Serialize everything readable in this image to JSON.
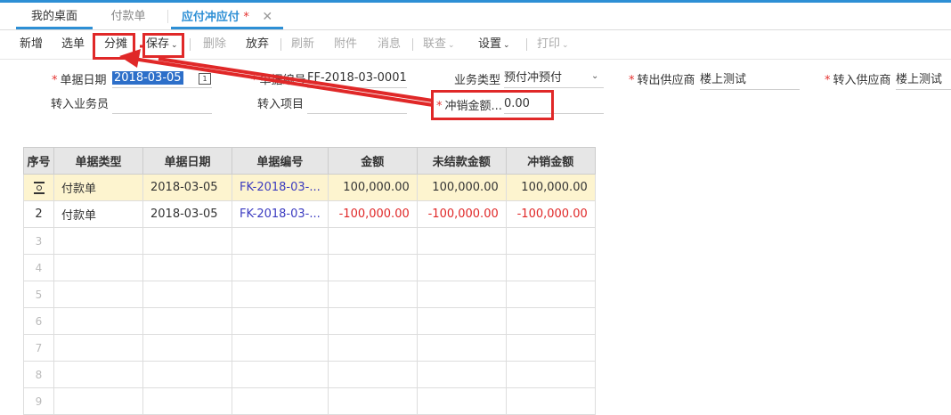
{
  "tabs": {
    "home": "我的桌面",
    "payment": "付款单",
    "active": "应付冲应付",
    "modified_mark": "*",
    "close": "✕"
  },
  "toolbar": {
    "add": "新增",
    "select": "选单",
    "allocate": "分摊",
    "save": "保存",
    "delete": "删除",
    "discard": "放弃",
    "refresh": "刷新",
    "attach": "附件",
    "message": "消息",
    "linkquery": "联查",
    "settings": "设置",
    "print": "打印",
    "chevron": "⌄"
  },
  "form": {
    "doc_date_label": "单据日期",
    "doc_date_value": "2018-03-05",
    "doc_no_label": "单据编号",
    "doc_no_value": "FF-2018-03-0001",
    "biz_type_label": "业务类型",
    "biz_type_value": "预付冲预付",
    "out_supplier_label": "转出供应商",
    "out_supplier_value": "楼上测试",
    "in_supplier_label": "转入供应商",
    "in_supplier_value": "楼上测试",
    "in_salesman_label": "转入业务员",
    "in_salesman_value": "",
    "in_project_label": "转入项目",
    "in_project_value": "",
    "writeoff_label": "冲销金额...",
    "writeoff_value": "0.00",
    "required_mark": "*",
    "calendar_glyph": "1"
  },
  "table": {
    "headers": [
      "序号",
      "单据类型",
      "单据日期",
      "单据编号",
      "金额",
      "未结款金额",
      "冲销金额"
    ],
    "rows": [
      {
        "idx": "",
        "type": "付款单",
        "date": "2018-03-05",
        "no": "FK-2018-03-...",
        "amount": "100,000.00",
        "unsettled": "100,000.00",
        "writeoff": "100,000.00"
      },
      {
        "idx": "2",
        "type": "付款单",
        "date": "2018-03-05",
        "no": "FK-2018-03-...",
        "amount": "-100,000.00",
        "unsettled": "-100,000.00",
        "writeoff": "-100,000.00"
      }
    ],
    "empty_rows": [
      "3",
      "4",
      "5",
      "6",
      "7",
      "8",
      "9"
    ]
  },
  "colors": {
    "accent": "#2d8fd5",
    "annotation": "#e02828",
    "selected_row": "#fdf4cf",
    "negative": "#e02828",
    "link": "#3b3bc0"
  }
}
